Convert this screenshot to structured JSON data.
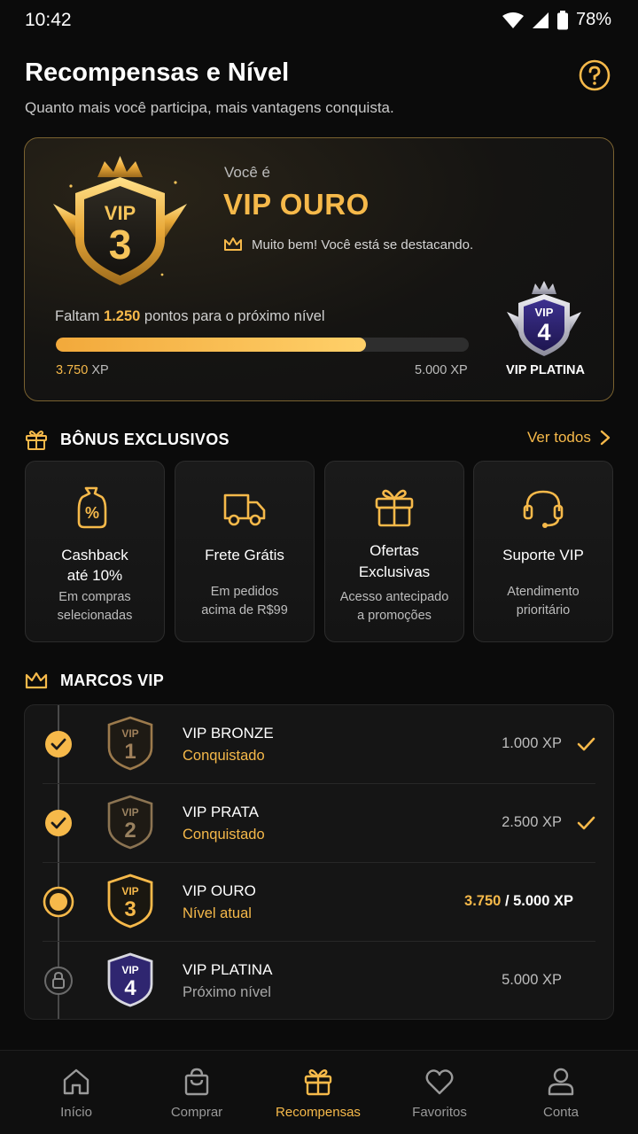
{
  "status_bar": {
    "time": "10:42",
    "battery": "78%"
  },
  "header": {
    "title": "Recompensas e Nível",
    "subtitle": "Quanto mais você participa, mais vantagens conquista."
  },
  "hero": {
    "badge_label": "VIP",
    "badge_number": "3",
    "you_are": "Você é",
    "level_name": "VIP OURO",
    "message": "Muito bem! Você está se destacando.",
    "missing_prefix": "Faltam",
    "missing_points": "1.250",
    "missing_suffix": "pontos para o próximo nível",
    "progress": 0.75,
    "xp_current": "3.750",
    "xp_unit": "XP",
    "xp_max": "5.000 XP",
    "next_badge_label": "VIP",
    "next_badge_number": "4",
    "next_level_name": "VIP PLATINA"
  },
  "bonus": {
    "section_title": "BÔNUS EXCLUSIVOS",
    "see_all": "Ver todos",
    "cards": [
      {
        "icon": "cashback-tag-icon",
        "title_line1": "Cashback",
        "title_line2": "até 10%",
        "desc_line1": "Em compras",
        "desc_line2": "selecionadas"
      },
      {
        "icon": "truck-icon",
        "title_line1": "Frete Grátis",
        "title_line2": "",
        "desc_line1": "Em pedidos",
        "desc_line2": "acima de R$99"
      },
      {
        "icon": "gift-icon",
        "title_line1": "Ofertas",
        "title_line2": "Exclusivas",
        "desc_line1": "Acesso antecipado",
        "desc_line2": "a promoções"
      },
      {
        "icon": "headset-icon",
        "title_line1": "Suporte VIP",
        "title_line2": "",
        "desc_line1": "Atendimento",
        "desc_line2": "prioritário"
      }
    ]
  },
  "milestones": {
    "section_title": "MARCOS VIP",
    "items": [
      {
        "badge_label": "VIP",
        "badge_number": "1",
        "name": "VIP BRONZE",
        "status": "Conquistado",
        "xp": "1.000 XP"
      },
      {
        "badge_label": "VIP",
        "badge_number": "2",
        "name": "VIP PRATA",
        "status": "Conquistado",
        "xp": "2.500 XP"
      },
      {
        "badge_label": "VIP",
        "badge_number": "3",
        "name": "VIP OURO",
        "status": "Nível atual",
        "xp_current": "3.750",
        "xp_rest": "/ 5.000 XP"
      },
      {
        "badge_label": "VIP",
        "badge_number": "4",
        "name": "VIP PLATINA",
        "status": "Próximo nível",
        "xp": "5.000 XP"
      }
    ]
  },
  "nav": {
    "items": [
      {
        "label": "Início",
        "icon": "home-icon"
      },
      {
        "label": "Comprar",
        "icon": "shopping-bag-icon"
      },
      {
        "label": "Recompensas",
        "icon": "gift-icon"
      },
      {
        "label": "Favoritos",
        "icon": "heart-icon"
      },
      {
        "label": "Conta",
        "icon": "user-icon"
      }
    ],
    "active": "Recompensas"
  },
  "colors": {
    "accent": "#f6b94a",
    "background": "#0b0b0b",
    "card": "#151515",
    "platinum": "#3a2f7a"
  }
}
